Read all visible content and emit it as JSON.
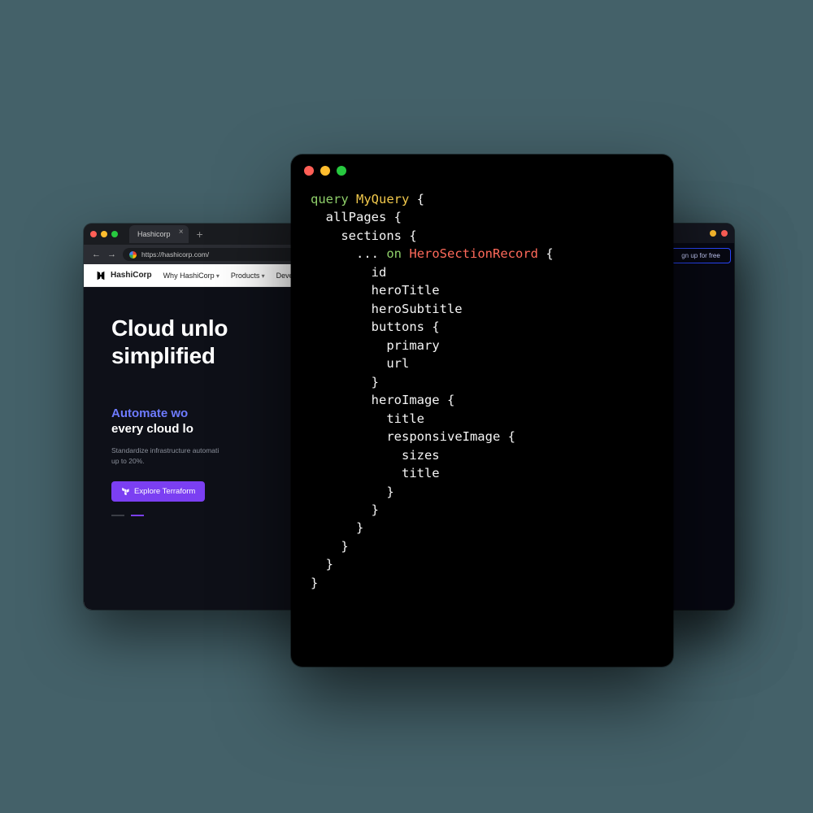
{
  "browser": {
    "tab_title": "Hashicorp",
    "url": "https://hashicorp.com/",
    "nav": {
      "brand": "HashiCorp",
      "items": [
        "Why HashiCorp",
        "Products",
        "Developers"
      ]
    },
    "hero": {
      "title_line1": "Cloud unlo",
      "title_line2": "simplified",
      "sub_blue": "Automate wo",
      "sub_white": "every cloud lo",
      "blurb_line1": "Standardize infrastructure automati",
      "blurb_line2": "up to 20%.",
      "cta": "Explore Terraform"
    }
  },
  "right": {
    "signup": "gn up for free"
  },
  "code": {
    "kw_query": "query",
    "name": "MyQuery",
    "kw_on": "on",
    "type": "HeroSectionRecord",
    "l_allpages": "allPages",
    "l_sections": "sections",
    "l_spread": "...",
    "f_id": "id",
    "f_heroTitle": "heroTitle",
    "f_heroSubtitle": "heroSubtitle",
    "f_buttons": "buttons",
    "f_primary": "primary",
    "f_url": "url",
    "f_heroImage": "heroImage",
    "f_title": "title",
    "f_responsiveImage": "responsiveImage",
    "f_sizes": "sizes",
    "f_title2": "title"
  }
}
